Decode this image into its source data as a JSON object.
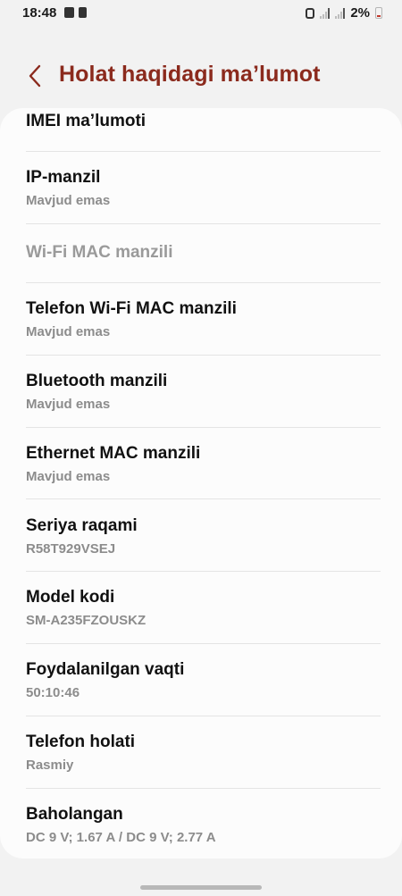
{
  "status_bar": {
    "time": "18:48",
    "battery_text": "2%"
  },
  "header": {
    "title": "Holat haqidagi ma’lumot",
    "back_icon": "chevron-left-icon",
    "title_color": "#8b2a1d"
  },
  "items": [
    {
      "title": "IMEI ma’lumoti",
      "subtitle": ""
    },
    {
      "title": "IP-manzil",
      "subtitle": "Mavjud emas"
    },
    {
      "title": "Wi-Fi MAC manzili",
      "subtitle": ""
    },
    {
      "title": "Telefon Wi-Fi MAC manzili",
      "subtitle": "Mavjud emas"
    },
    {
      "title": "Bluetooth manzili",
      "subtitle": "Mavjud emas"
    },
    {
      "title": "Ethernet MAC manzili",
      "subtitle": "Mavjud emas"
    },
    {
      "title": "Seriya raqami",
      "subtitle": "R58T929VSEJ"
    },
    {
      "title": "Model kodi",
      "subtitle": "SM-A235FZOUSKZ"
    },
    {
      "title": "Foydalanilgan vaqti",
      "subtitle": "50:10:46"
    },
    {
      "title": "Telefon holati",
      "subtitle": "Rasmiy"
    },
    {
      "title": "Baholangan",
      "subtitle": "DC 9 V; 1.67 A / DC 9 V; 2.77 A"
    }
  ]
}
